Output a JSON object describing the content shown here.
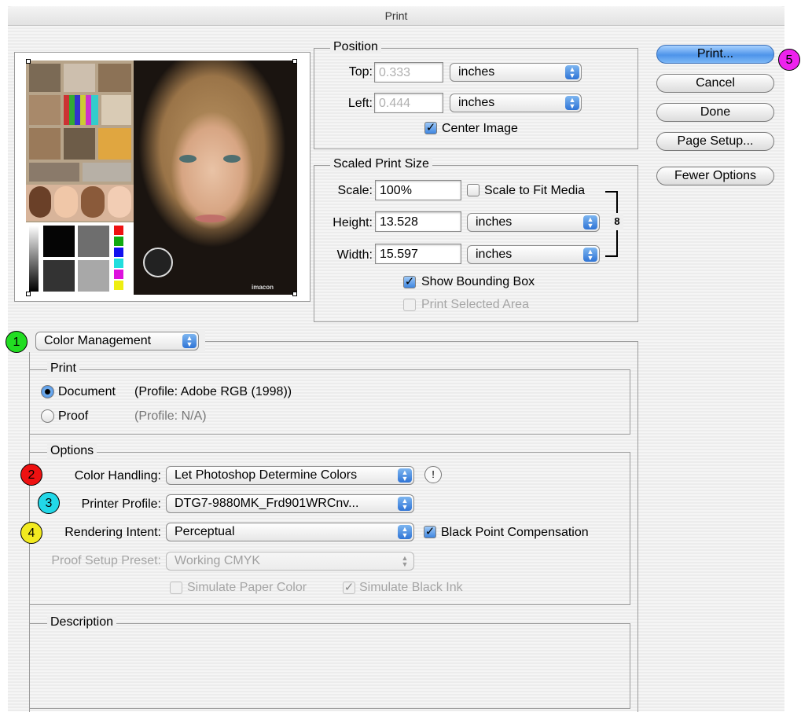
{
  "window": {
    "title": "Print"
  },
  "position": {
    "group_label": "Position",
    "top_label": "Top:",
    "top_value": "0.333",
    "top_unit": "inches",
    "left_label": "Left:",
    "left_value": "0.444",
    "left_unit": "inches",
    "center_image_label": "Center Image",
    "center_image_checked": true
  },
  "scaled": {
    "group_label": "Scaled Print Size",
    "scale_label": "Scale:",
    "scale_value": "100%",
    "scale_to_fit_label": "Scale to Fit Media",
    "height_label": "Height:",
    "height_value": "13.528",
    "height_unit": "inches",
    "width_label": "Width:",
    "width_value": "15.597",
    "width_unit": "inches",
    "link_icon": "chain-link-icon",
    "show_bbox_label": "Show Bounding Box",
    "print_selected_label": "Print Selected Area"
  },
  "buttons": {
    "print": "Print...",
    "cancel": "Cancel",
    "done": "Done",
    "page_setup": "Page Setup...",
    "fewer_options": "Fewer Options"
  },
  "section_popup": "Color Management",
  "print_group": {
    "label": "Print",
    "document_label": "Document",
    "document_profile": "(Profile: Adobe RGB (1998))",
    "proof_label": "Proof",
    "proof_profile": "(Profile: N/A)",
    "selected": "Document"
  },
  "options": {
    "label": "Options",
    "color_handling_label": "Color Handling:",
    "color_handling_value": "Let Photoshop Determine Colors",
    "printer_profile_label": "Printer Profile:",
    "printer_profile_value": "DTG7-9880MK_Frd901WRCnv...",
    "rendering_intent_label": "Rendering Intent:",
    "rendering_intent_value": "Perceptual",
    "bpc_label": "Black Point Compensation",
    "proof_setup_label": "Proof Setup Preset:",
    "proof_setup_value": "Working CMYK",
    "simulate_paper_label": "Simulate Paper Color",
    "simulate_ink_label": "Simulate Black Ink"
  },
  "description": {
    "label": "Description"
  },
  "preview": {
    "logo_text": "imacon"
  },
  "badges": [
    "1",
    "2",
    "3",
    "4",
    "5"
  ],
  "colors": {
    "badge1": "#22dd22",
    "badge2": "#ee1111",
    "badge3": "#22d8e8",
    "badge4": "#f2ea20",
    "badge5": "#ee22ee",
    "accent": "#4d94ea"
  }
}
